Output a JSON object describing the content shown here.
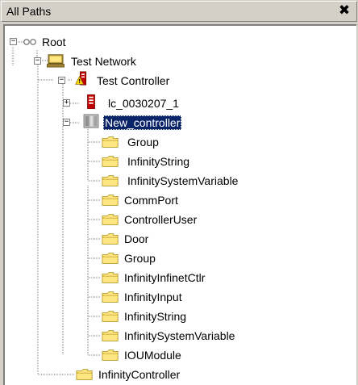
{
  "panel": {
    "title": "All Paths",
    "close_glyph": "✖"
  },
  "tree": {
    "root": {
      "label": "Root",
      "icon": "network-root-icon",
      "expander": "−"
    },
    "test_network": {
      "label": "Test Network",
      "icon": "computer-icon",
      "expander": "−"
    },
    "test_controller": {
      "label": "Test Controller",
      "icon": "controller-alarm-icon",
      "expander": "−"
    },
    "lc_node": {
      "label": "lc_0030207_1",
      "icon": "red-controller-icon",
      "expander": "+"
    },
    "new_controller": {
      "label": "New_controller",
      "icon": "grey-controller-icon",
      "expander": "−",
      "selected": true
    },
    "new_controller_children": [
      {
        "label": "Group",
        "icon": "folder-icon"
      },
      {
        "label": "InfinityString",
        "icon": "folder-icon"
      },
      {
        "label": "InfinitySystemVariable",
        "icon": "folder-icon"
      }
    ],
    "test_controller_children": [
      {
        "label": "CommPort",
        "icon": "folder-icon"
      },
      {
        "label": "ControllerUser",
        "icon": "folder-icon"
      },
      {
        "label": "Door",
        "icon": "folder-icon"
      },
      {
        "label": "Group",
        "icon": "folder-icon"
      },
      {
        "label": "InfinityInfinetCtlr",
        "icon": "folder-icon"
      },
      {
        "label": "InfinityInput",
        "icon": "folder-icon"
      },
      {
        "label": "InfinityString",
        "icon": "folder-icon"
      },
      {
        "label": "InfinitySystemVariable",
        "icon": "folder-icon"
      },
      {
        "label": "IOUModule",
        "icon": "folder-icon"
      }
    ],
    "infinity_controller": {
      "label": "InfinityController",
      "icon": "folder-icon"
    }
  },
  "colors": {
    "selection": "#0a246a",
    "folder": "#ffe680",
    "folder_edge": "#b89a2c",
    "dotted_line": "#808080"
  }
}
